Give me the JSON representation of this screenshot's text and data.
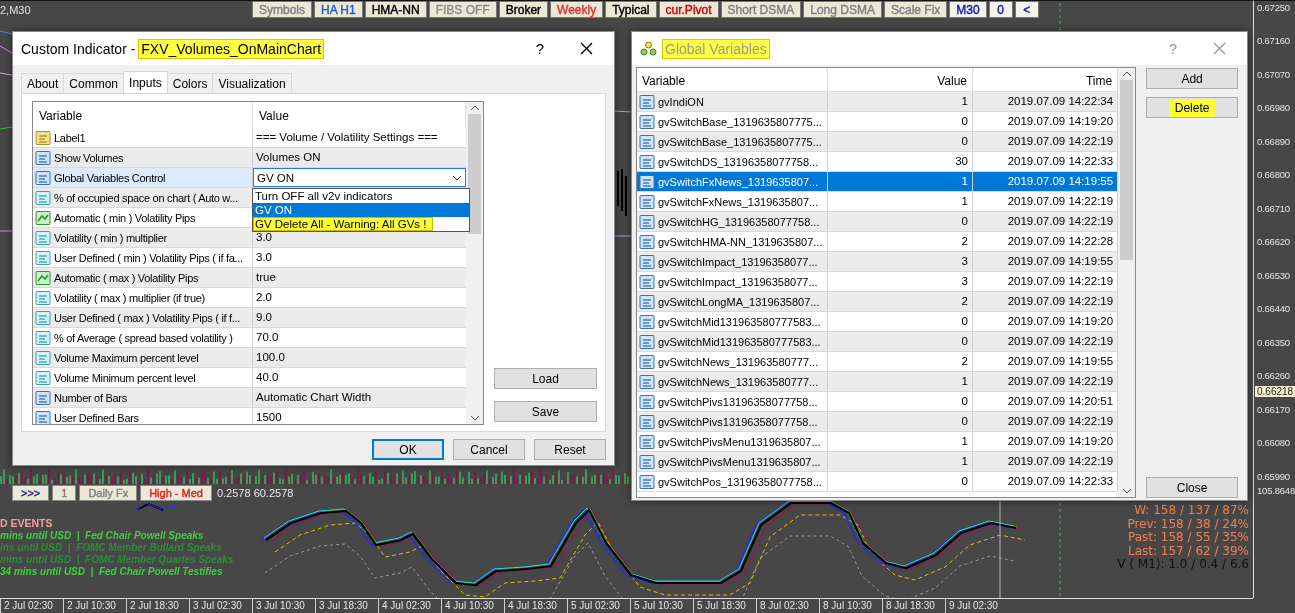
{
  "chart": {
    "symbol_label": "2,M30",
    "toolbar": [
      {
        "label": "Symbols",
        "color": "#7f7f7f"
      },
      {
        "label": "HA H1",
        "color": "#1f5fbf"
      },
      {
        "label": "HMA-NN",
        "color": "#000000"
      },
      {
        "label": "FIBS OFF",
        "color": "#8a8a8a"
      },
      {
        "label": "Broker",
        "color": "#000000"
      },
      {
        "label": "Weekly",
        "color": "#e03030"
      },
      {
        "label": "Typical",
        "color": "#000000"
      },
      {
        "label": "cur.Pivot",
        "color": "#d00000"
      },
      {
        "label": "Short DSMA",
        "color": "#7f7f7f"
      },
      {
        "label": "Long DSMA",
        "color": "#7f7f7f"
      },
      {
        "label": "Scale Fix",
        "color": "#7f7f7f"
      },
      {
        "label": "M30",
        "color": "#1010c0"
      },
      {
        "label": "0",
        "color": "#1010c0"
      },
      {
        "label": "<",
        "color": "#1010c0"
      }
    ],
    "indicator_buttons": [
      {
        "label": ">>>",
        "color": "#1a1a90"
      },
      {
        "label": "1",
        "color": "#7f7f7f"
      },
      {
        "label": "Daily Fx",
        "color": "#7f7f7f"
      },
      {
        "label": "High - Med",
        "color": "#e02020"
      }
    ],
    "indicator_readout": "0.2578 60.2578",
    "events_title": "D EVENTS",
    "events": [
      {
        "text": "mins until USD  |  Fed Chair Powell Speaks",
        "color": "#3ecf3e"
      },
      {
        "text": "ins until USD  |  FOMC Member Bullard Speaks",
        "color": "#2e8b3e"
      },
      {
        "text": "mins until USD  |  FOMC Member Quarles Speaks",
        "color": "#2e8b3e"
      },
      {
        "text": "34 mins until USD  |  Fed Chair Powell Testifies",
        "color": "#3ecf3e"
      }
    ],
    "stats": [
      {
        "text": "W: 158 / 137 / 87%",
        "color": "#f08050"
      },
      {
        "text": "Prev: 158 / 38 / 24%",
        "color": "#f08050"
      },
      {
        "text": "Past: 158 / 55 / 35%",
        "color": "#f08050"
      },
      {
        "text": "Last: 157 / 62 / 39%",
        "color": "#f08050"
      },
      {
        "text": "V ( M1): 1.0 / 0.4 / 6.6",
        "color": "#101010"
      }
    ],
    "price_axis": [
      "0.67250",
      "0.67160",
      "0.67070",
      "0.66980",
      "0.66890",
      "0.66800",
      "0.66710",
      "0.66620",
      "0.66530",
      "0.66440",
      "0.66350",
      "0.66260",
      "0.66170",
      "0.66080",
      "0.65990"
    ],
    "current_price": "0.66218",
    "indicator_scale": "105.8648",
    "time_axis": [
      "2 Jul 02:30",
      "2 Jul 10:30",
      "2 Jul 18:30",
      "3 Jul 02:30",
      "3 Jul 10:30",
      "3 Jul 18:30",
      "4 Jul 02:30",
      "4 Jul 10:30",
      "4 Jul 18:30",
      "5 Jul 02:30",
      "5 Jul 10:30",
      "5 Jul 18:30",
      "8 Jul 02:30",
      "8 Jul 10:30",
      "8 Jul 18:30",
      "9 Jul 02:30"
    ]
  },
  "indicator_dialog": {
    "active": true,
    "title": "Custom Indicator - ",
    "title_name": "FXV_Volumes_OnMainChart",
    "name_highlighted": true,
    "help": "?",
    "tabs": [
      {
        "label": "About",
        "selected": false
      },
      {
        "label": "Common",
        "selected": false
      },
      {
        "label": "Inputs",
        "selected": true
      },
      {
        "label": "Colors",
        "selected": false
      },
      {
        "label": "Visualization",
        "selected": false
      }
    ],
    "columns": [
      "Variable",
      "Value"
    ],
    "rows": [
      {
        "kind": "text",
        "name": "Label1",
        "value": "=== Volume / Volatility Settings ===",
        "selected": false
      },
      {
        "kind": "integer",
        "name": "Show Volumes",
        "value": "Volumes ON",
        "selected": false
      },
      {
        "kind": "integer",
        "name": "Global Variables Control",
        "value": "GV ON",
        "selected": true,
        "dropdown": [
          {
            "label": "Turn OFF all v2v indicators",
            "selected": false,
            "highlighted": false
          },
          {
            "label": "GV ON",
            "selected": true,
            "highlighted": false
          },
          {
            "label": "GV Delete All - Warning: All GVs !",
            "selected": false,
            "highlighted": true
          }
        ]
      },
      {
        "kind": "double",
        "name": "% of occupied space on chart ( Auto w...",
        "selected": false
      },
      {
        "kind": "bool",
        "name": "Automatic ( min ) Volatility Pips",
        "selected": false
      },
      {
        "kind": "double",
        "name": "Volatility ( min ) multiplier",
        "value": "3.0",
        "selected": false
      },
      {
        "kind": "double",
        "name": "User Defined ( min ) Volatility Pips ( if fa...",
        "value": "3.0",
        "selected": false
      },
      {
        "kind": "bool",
        "name": "Automatic ( max ) Volatility Pips",
        "value": "true",
        "selected": false
      },
      {
        "kind": "double",
        "name": "Volatility ( max ) multiplier (if true)",
        "value": "2.0",
        "selected": false
      },
      {
        "kind": "double",
        "name": "User Defined ( max ) Volatility Pips ( if f...",
        "value": "9.0",
        "selected": false
      },
      {
        "kind": "double",
        "name": "% of Average ( spread based volatility )",
        "value": "70.0",
        "selected": false
      },
      {
        "kind": "double",
        "name": "Volume Maximum percent level",
        "value": "100.0",
        "selected": false
      },
      {
        "kind": "double",
        "name": "Volume Minimum percent level",
        "value": "40.0",
        "selected": false
      },
      {
        "kind": "integer",
        "name": "Number of Bars",
        "value": "Automatic Chart Width",
        "selected": false
      },
      {
        "kind": "integer",
        "name": "User Defined Bars",
        "value": "1500",
        "selected": false
      }
    ],
    "side_buttons": [
      "Load",
      "Save"
    ],
    "buttons": [
      {
        "label": "OK",
        "default": true
      },
      {
        "label": "Cancel",
        "default": false
      },
      {
        "label": "Reset",
        "default": false
      }
    ]
  },
  "gv_dialog": {
    "active": false,
    "title": "Global Variables",
    "title_highlighted": true,
    "help": "?",
    "columns": [
      "Variable",
      "Value",
      "Time"
    ],
    "rows": [
      {
        "name": "gvIndiON",
        "value": "1",
        "time": "2019.07.09 14:22:34",
        "selected": false
      },
      {
        "name": "gvSwitchBase_1319635807775...",
        "value": "0",
        "time": "2019.07.09 14:19:20",
        "selected": false
      },
      {
        "name": "gvSwitchBase_1319635807775...",
        "value": "0",
        "time": "2019.07.09 14:22:19",
        "selected": false
      },
      {
        "name": "gvSwitchDS_13196358077758...",
        "value": "30",
        "time": "2019.07.09 14:22:33",
        "selected": false
      },
      {
        "name": "gvSwitchFxNews_1319635807...",
        "value": "1",
        "time": "2019.07.09 14:19:55",
        "selected": true
      },
      {
        "name": "gvSwitchFxNews_1319635807...",
        "value": "1",
        "time": "2019.07.09 14:22:19",
        "selected": false
      },
      {
        "name": "gvSwitchHG_13196358077758...",
        "value": "0",
        "time": "2019.07.09 14:22:19",
        "selected": false
      },
      {
        "name": "gvSwitchHMA-NN_1319635807...",
        "value": "2",
        "time": "2019.07.09 14:22:28",
        "selected": false
      },
      {
        "name": "gvSwitchImpact_13196358077...",
        "value": "3",
        "time": "2019.07.09 14:19:55",
        "selected": false
      },
      {
        "name": "gvSwitchImpact_13196358077...",
        "value": "3",
        "time": "2019.07.09 14:22:19",
        "selected": false
      },
      {
        "name": "gvSwitchLongMA_1319635807...",
        "value": "2",
        "time": "2019.07.09 14:22:19",
        "selected": false
      },
      {
        "name": "gvSwitchMid131963580777583...",
        "value": "0",
        "time": "2019.07.09 14:19:20",
        "selected": false
      },
      {
        "name": "gvSwitchMid131963580777583...",
        "value": "0",
        "time": "2019.07.09 14:22:19",
        "selected": false
      },
      {
        "name": "gvSwitchNews_131963580777...",
        "value": "2",
        "time": "2019.07.09 14:19:55",
        "selected": false
      },
      {
        "name": "gvSwitchNews_131963580777...",
        "value": "1",
        "time": "2019.07.09 14:22:19",
        "selected": false
      },
      {
        "name": "gvSwitchPivs13196358077758...",
        "value": "0",
        "time": "2019.07.09 14:20:51",
        "selected": false
      },
      {
        "name": "gvSwitchPivs13196358077758...",
        "value": "0",
        "time": "2019.07.09 14:22:19",
        "selected": false
      },
      {
        "name": "gvSwitchPivsMenu1319635807...",
        "value": "1",
        "time": "2019.07.09 14:19:20",
        "selected": false
      },
      {
        "name": "gvSwitchPivsMenu1319635807...",
        "value": "1",
        "time": "2019.07.09 14:22:19",
        "selected": false
      },
      {
        "name": "gvSwitchPos_13196358077758...",
        "value": "0",
        "time": "2019.07.09 14:22:33",
        "selected": false
      }
    ],
    "buttons": [
      {
        "label": "Add",
        "highlighted": false
      },
      {
        "label": "Delete",
        "highlighted": true
      }
    ],
    "close_button": "Close"
  }
}
